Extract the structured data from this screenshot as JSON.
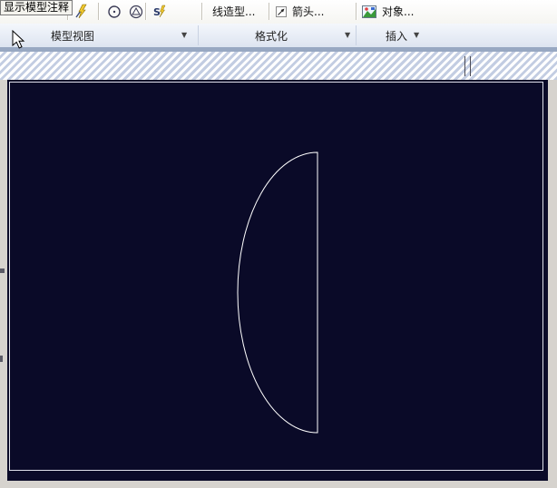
{
  "tooltip": {
    "text": "显示模型注释"
  },
  "toolbar": {
    "row1": {
      "line_style_button": "线造型...",
      "arrow_button": "箭头...",
      "object_button": "对象..."
    },
    "row2": {
      "groups": [
        {
          "label": "模型视图"
        },
        {
          "label": "格式化"
        },
        {
          "label": "插入"
        }
      ],
      "arrow_glyph": "▼"
    }
  },
  "colors": {
    "canvas_background": "#0a0a28",
    "shape_stroke": "#ffffff",
    "hatch_stripe": "#c3cde2",
    "toolbar_background": "#ecebe4"
  },
  "drawing": {
    "shape": "half-ellipse-outline",
    "description": "vertical chord with left-bulging arc"
  }
}
